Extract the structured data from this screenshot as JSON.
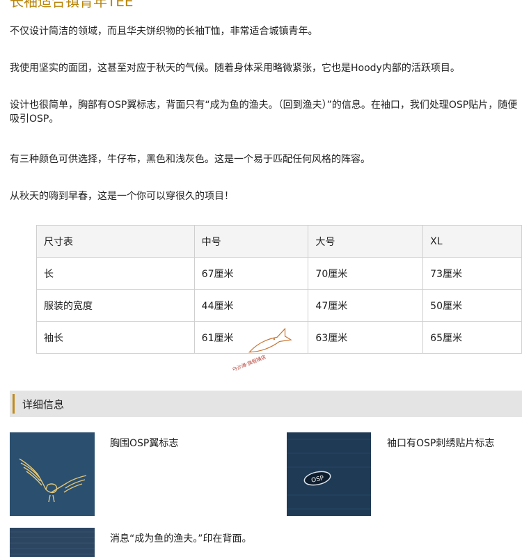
{
  "page": {
    "title": "长袖适合镇青年TEE",
    "paragraphs": [
      "不仅设计简洁的领域，而且华夫饼织物的长袖T恤，非常适合城镇青年。",
      "我使用坚实的面团，这甚至对应于秋天的气候。随着身体采用略微紧张，它也是Hoody内部的活跃项目。",
      "设计也很简单，胸部有OSP翼标志，背面只有“成为鱼的渔夫。（回到渔夫）”的信息。在袖口，我们处理OSP贴片，随便吸引OSP。",
      "有三种颜色可供选择，牛仔布，黑色和浅灰色。这是一个易于匹配任何风格的阵容。",
      "从秋天的嗨到早春，这是一个你可以穿很久的项目！"
    ]
  },
  "size_table": {
    "header": [
      "尺寸表",
      "中号",
      "大号",
      "XL"
    ],
    "rows": [
      [
        "长",
        "67厘米",
        "70厘米",
        "73厘米"
      ],
      [
        "服装的宽度",
        "44厘米",
        "47厘米",
        "50厘米"
      ],
      [
        "袖长",
        "61厘米",
        "63厘米",
        "65厘米"
      ]
    ]
  },
  "watermark": {
    "text": "白沙滩·旗舰铺店"
  },
  "details": {
    "section_title": "详细信息",
    "items": [
      {
        "caption": "胸围OSP翼标志",
        "icon": "eagle-wing-logo"
      },
      {
        "caption": "袖口有OSP刺绣贴片标志",
        "icon": "osp-patch",
        "patch_text": "OSP"
      },
      {
        "caption": "消息“成为鱼的渔夫。”印在背面。",
        "icon": "fabric-back"
      }
    ]
  },
  "colors": {
    "title": "#b8860b",
    "accent": "#c08a1a",
    "fabric": "#2b4f6e"
  }
}
